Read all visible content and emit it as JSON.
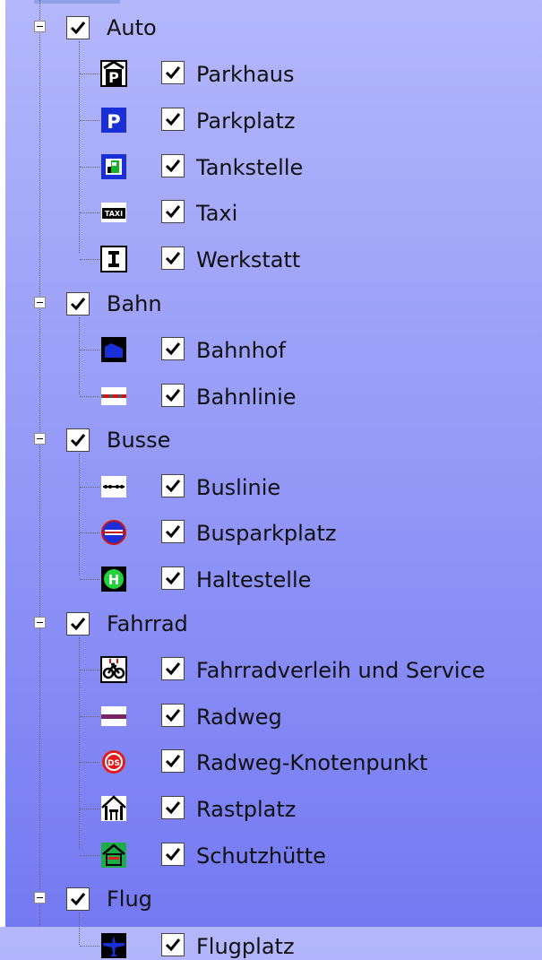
{
  "tree": {
    "groups": [
      {
        "label": "Auto",
        "expanded": true,
        "checked": true,
        "items": [
          {
            "label": "Parkhaus",
            "icon": "parking-garage-icon",
            "checked": true
          },
          {
            "label": "Parkplatz",
            "icon": "parking-icon",
            "checked": true
          },
          {
            "label": "Tankstelle",
            "icon": "gas-station-icon",
            "checked": true
          },
          {
            "label": "Taxi",
            "icon": "taxi-icon",
            "checked": true
          },
          {
            "label": "Werkstatt",
            "icon": "workshop-icon",
            "checked": true
          }
        ]
      },
      {
        "label": "Bahn",
        "expanded": true,
        "checked": true,
        "items": [
          {
            "label": "Bahnhof",
            "icon": "train-station-icon",
            "checked": true
          },
          {
            "label": "Bahnlinie",
            "icon": "rail-line-icon",
            "checked": true
          }
        ]
      },
      {
        "label": "Busse",
        "expanded": true,
        "checked": true,
        "items": [
          {
            "label": "Buslinie",
            "icon": "bus-line-icon",
            "checked": true
          },
          {
            "label": "Busparkplatz",
            "icon": "bus-parking-icon",
            "checked": true
          },
          {
            "label": "Haltestelle",
            "icon": "bus-stop-icon",
            "checked": true
          }
        ]
      },
      {
        "label": "Fahrrad",
        "expanded": true,
        "checked": true,
        "items": [
          {
            "label": "Fahrradverleih und Service",
            "icon": "bicycle-rental-icon",
            "checked": true
          },
          {
            "label": "Radweg",
            "icon": "bike-path-icon",
            "checked": true
          },
          {
            "label": "Radweg-Knotenpunkt",
            "icon": "bike-junction-icon",
            "checked": true
          },
          {
            "label": "Rastplatz",
            "icon": "rest-area-icon",
            "checked": true
          },
          {
            "label": "Schutzhütte",
            "icon": "shelter-icon",
            "checked": true
          }
        ]
      },
      {
        "label": "Flug",
        "expanded": true,
        "checked": true,
        "items": [
          {
            "label": "Flugplatz",
            "icon": "airfield-icon",
            "checked": true
          }
        ]
      }
    ]
  }
}
